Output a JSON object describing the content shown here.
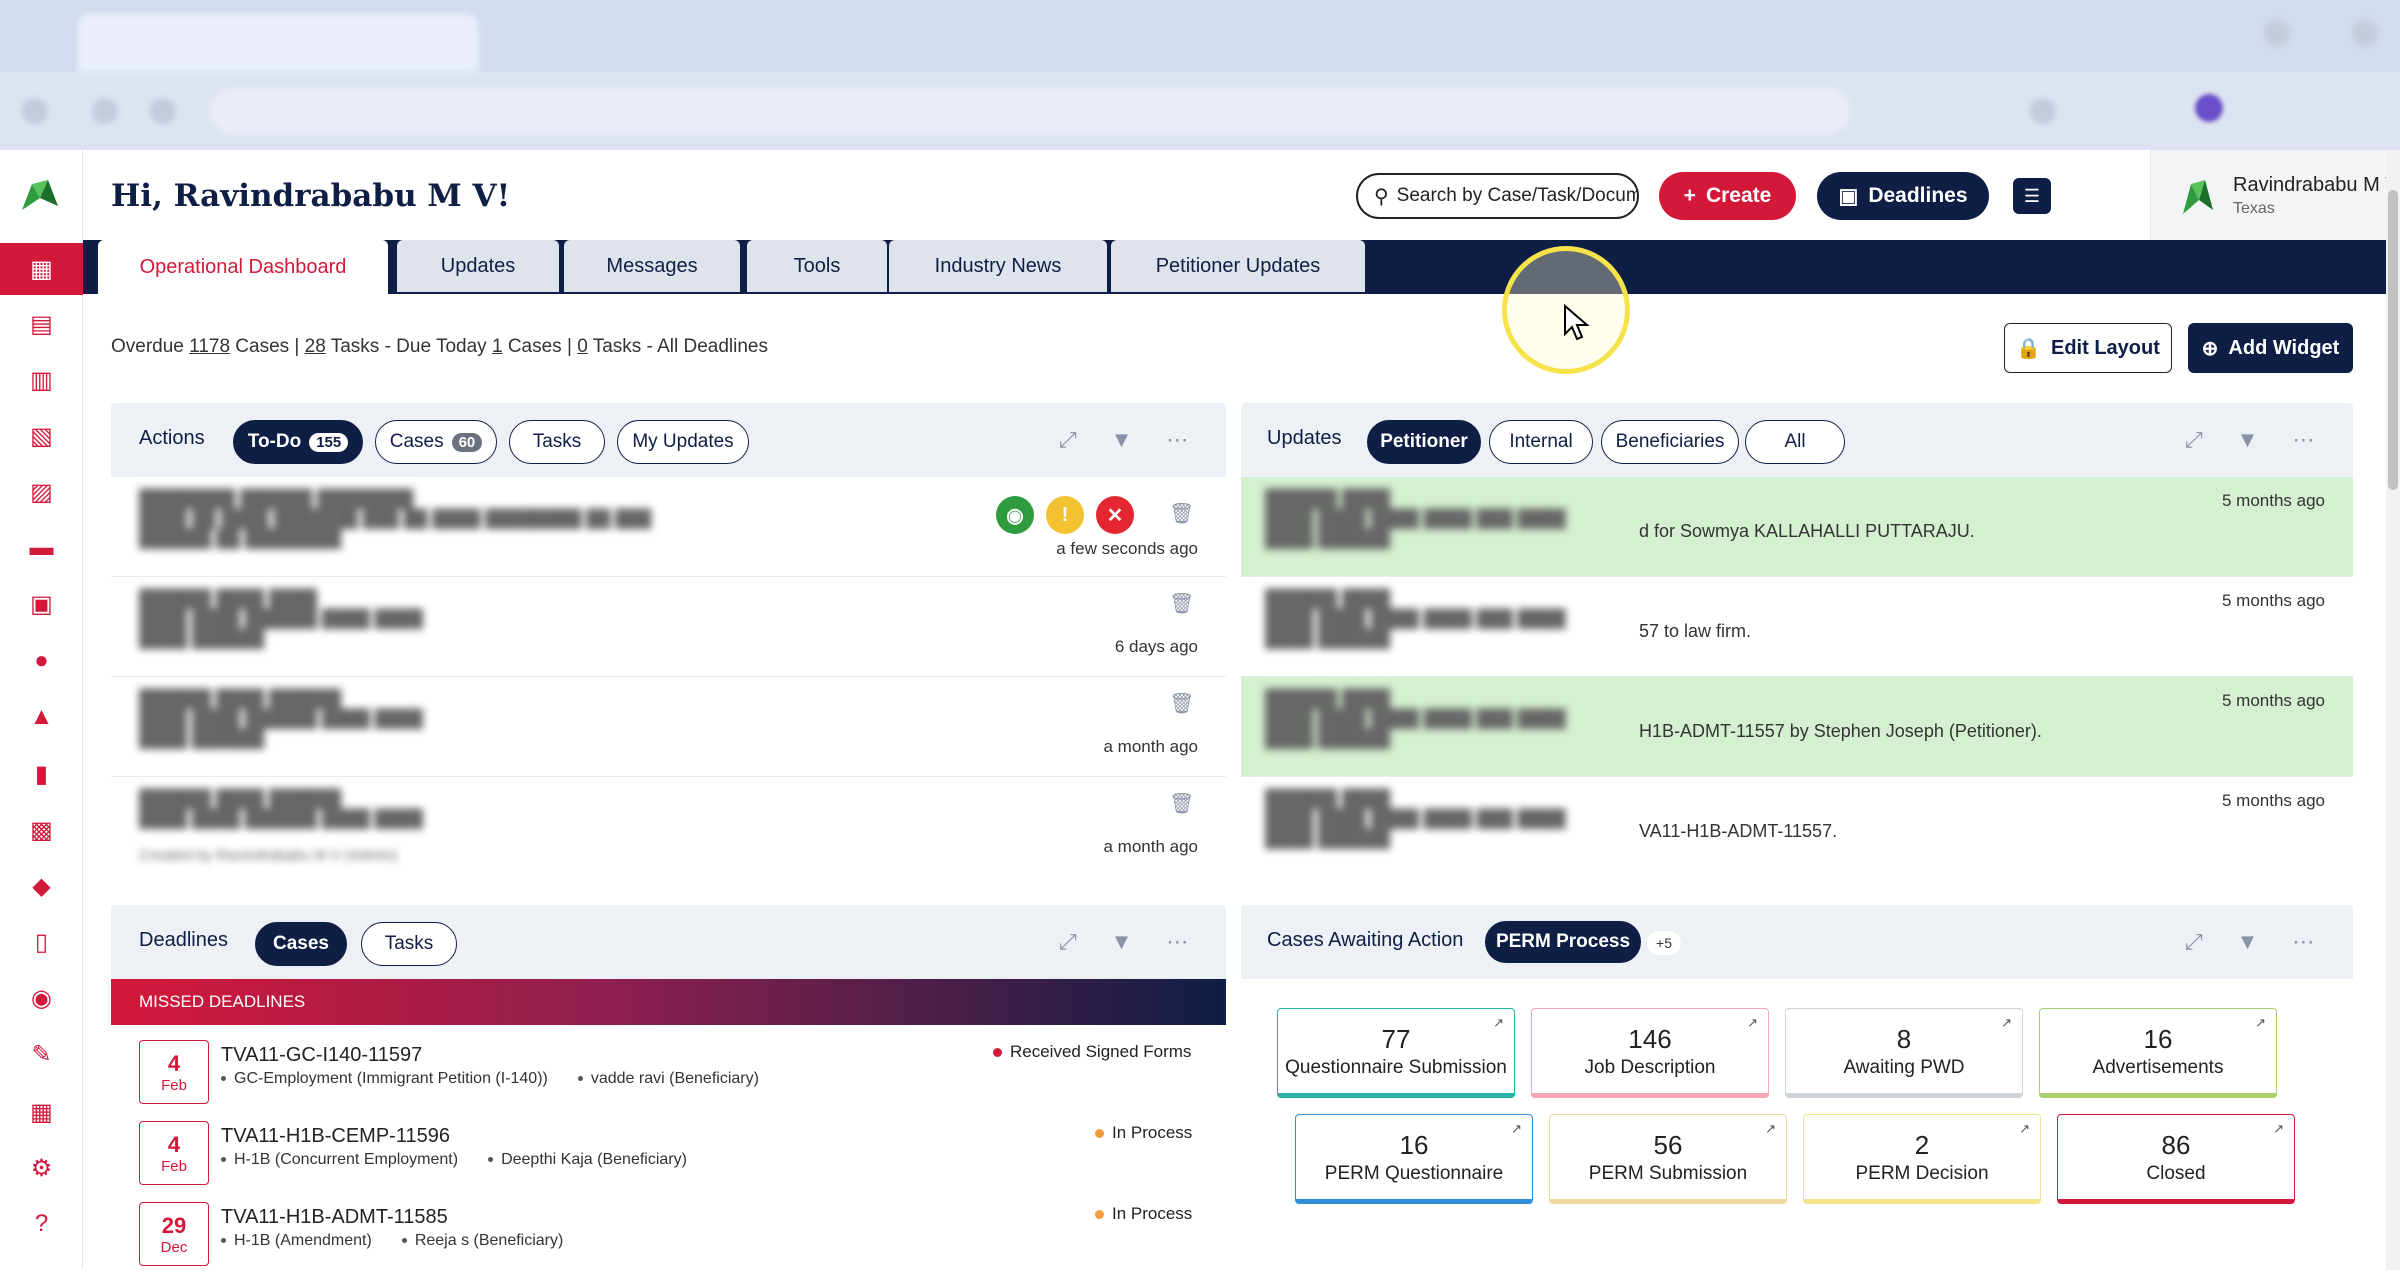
{
  "header": {
    "greeting": "Hi, Ravindrababu M V!",
    "search_placeholder": "Search by Case/Task/Document",
    "create_label": "Create",
    "deadlines_label": "Deadlines",
    "user_name": "Ravindrababu M V",
    "user_location": "Texas"
  },
  "nav_tabs": [
    {
      "label": "Operational Dashboard"
    },
    {
      "label": "Updates"
    },
    {
      "label": "Messages"
    },
    {
      "label": "Tools"
    },
    {
      "label": "Industry News"
    },
    {
      "label": "Petitioner Updates"
    }
  ],
  "stats": {
    "overdue_label": "Overdue",
    "overdue_cases": "1178",
    "cases_word": "Cases |",
    "overdue_tasks": "28",
    "tasks_due_today": "Tasks - Due Today",
    "today_cases": "1",
    "cases_word2": "Cases |",
    "today_tasks": "0",
    "tasks_all": "Tasks - All Deadlines"
  },
  "buttons": {
    "edit_layout": "Edit Layout",
    "add_widget": "Add Widget"
  },
  "actions_widget": {
    "title": "Actions",
    "chips": [
      {
        "label": "To-Do",
        "count": "155"
      },
      {
        "label": "Cases",
        "count": "60"
      },
      {
        "label": "Tasks"
      },
      {
        "label": "My Updates"
      }
    ],
    "rows": [
      {
        "time": "a few seconds ago"
      },
      {
        "time": "6 days ago"
      },
      {
        "time": "a month ago"
      },
      {
        "time": "a month ago"
      }
    ],
    "created_by": "Created by Ravindrababu M V (Admin)"
  },
  "updates_widget": {
    "title": "Updates",
    "chips": [
      "Petitioner",
      "Internal",
      "Beneficiaries",
      "All"
    ],
    "rows": [
      {
        "text": "d for Sowmya KALLAHALLI PUTTARAJU.",
        "time": "5 months ago"
      },
      {
        "text": "57 to law firm.",
        "time": "5 months ago"
      },
      {
        "text": "H1B-ADMT-11557 by Stephen Joseph (Petitioner).",
        "time": "5 months ago"
      },
      {
        "text": "VA11-H1B-ADMT-11557.",
        "time": "5 months ago"
      }
    ]
  },
  "deadlines_widget": {
    "title": "Deadlines",
    "chips": [
      "Cases",
      "Tasks"
    ],
    "missed_label": "MISSED DEADLINES",
    "rows": [
      {
        "day": "4",
        "month": "Feb",
        "case": "TVA11-GC-I140-11597",
        "type": "GC-Employment (Immigrant Petition (I-140))",
        "beneficiary": "vadde ravi (Beneficiary)",
        "status": "Received Signed Forms",
        "status_color": "#d4183a"
      },
      {
        "day": "4",
        "month": "Feb",
        "case": "TVA11-H1B-CEMP-11596",
        "type": "H-1B (Concurrent Employment)",
        "beneficiary": "Deepthi Kaja (Beneficiary)",
        "status": "In Process",
        "status_color": "#f39c3d"
      },
      {
        "day": "29",
        "month": "Dec",
        "case": "TVA11-H1B-ADMT-11585",
        "type": "H-1B (Amendment)",
        "beneficiary": "Reeja s (Beneficiary)",
        "status": "In Process",
        "status_color": "#f39c3d"
      }
    ]
  },
  "cases_widget": {
    "title": "Cases Awaiting Action",
    "chip": "PERM Process",
    "more": "+5",
    "tiles": [
      {
        "num": "77",
        "label": "Questionnaire Submission",
        "color": "#2ab3a6"
      },
      {
        "num": "146",
        "label": "Job Description",
        "color": "#f4a6b2"
      },
      {
        "num": "8",
        "label": "Awaiting PWD",
        "color": "#cfd3da"
      },
      {
        "num": "16",
        "label": "Advertisements",
        "color": "#a9cf6a"
      },
      {
        "num": "16",
        "label": "PERM Questionnaire",
        "color": "#2f8fd8"
      },
      {
        "num": "56",
        "label": "PERM Submission",
        "color": "#f0d9a0"
      },
      {
        "num": "2",
        "label": "PERM Decision",
        "color": "#f3e58a"
      },
      {
        "num": "86",
        "label": "Closed",
        "color": "#d4183a"
      }
    ]
  },
  "sidebar_icons": [
    "dashboard-icon",
    "document-icon",
    "form-icon",
    "calendar-icon",
    "checklist-icon",
    "message-icon",
    "clipboard-icon",
    "user-icon",
    "person-icon",
    "folder-icon",
    "notes-icon",
    "profile-icon",
    "book-icon",
    "team-icon",
    "edit-icon",
    "cal-icon",
    "gear-icon",
    "help-icon"
  ]
}
